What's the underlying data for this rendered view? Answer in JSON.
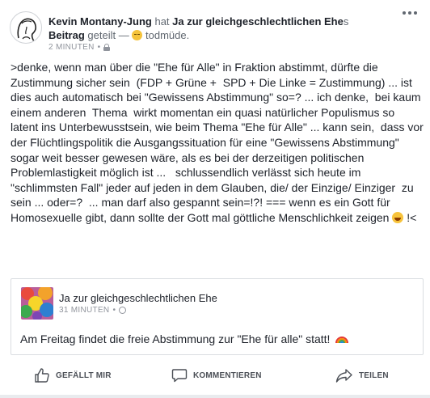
{
  "post": {
    "author": "Kevin Montany-Jung",
    "verb": "hat",
    "group": "Ja zur gleichgeschlechtlichen Ehe",
    "group_suffix": "s",
    "post_word": "Beitrag",
    "shared_word": "geteilt",
    "dash": "—",
    "feeling": "todmüde.",
    "feeling_icon": "sleepy-face-emoji",
    "time": "2 MINUTEN",
    "dot": "•",
    "privacy_icon": "lock-icon",
    "body_text": ">denke, wenn man über die \"Ehe für Alle\" in Fraktion abstimmt, dürfte die Zustimmung sicher sein  (FDP + Grüne +  SPD + Die Linke = Zustimmung) ... ist dies auch automatisch bei \"Gewissens Abstimmung\" so=? ... ich denke,  bei kaum einem anderen  Thema  wirkt momentan ein quasi natürlicher Populismus so latent ins Unterbewusstsein, wie beim Thema \"Ehe für Alle\" ... kann sein,  dass vor der Flüchtlingspolitik die Ausgangssituation für eine \"Gewissens Abstimmung\" sogar weit besser gewesen wäre, als es bei der derzeitigen politischen Problemlastigkeit möglich ist ...   schlussendlich verlässt sich heute im \"schlimmsten Fall\" jeder auf jeden in dem Glauben, die/ der Einzige/ Einziger  zu sein ... oder=?  ... man darf also gespannt sein=!?! === wenn es ein Gott für Homosexuelle gibt, dann sollte der Gott mal göttliche Menschlichkeit zeigen ",
    "body_end": " !<"
  },
  "shared": {
    "title": "Ja zur gleichgeschlechtlichen Ehe",
    "time": "31 MINUTEN",
    "dot": "•",
    "privacy_icon": "globe-icon",
    "text": "Am Freitag findet die freie Abstimmung zur \"Ehe für alle\" statt!"
  },
  "actions": {
    "like": "GEFÄLLT MIR",
    "comment": "KOMMENTIEREN",
    "share": "TEILEN"
  },
  "colors": {
    "text": "#1d2129",
    "muted": "#90949c",
    "action": "#4b4f56",
    "border": "#dadde1"
  }
}
